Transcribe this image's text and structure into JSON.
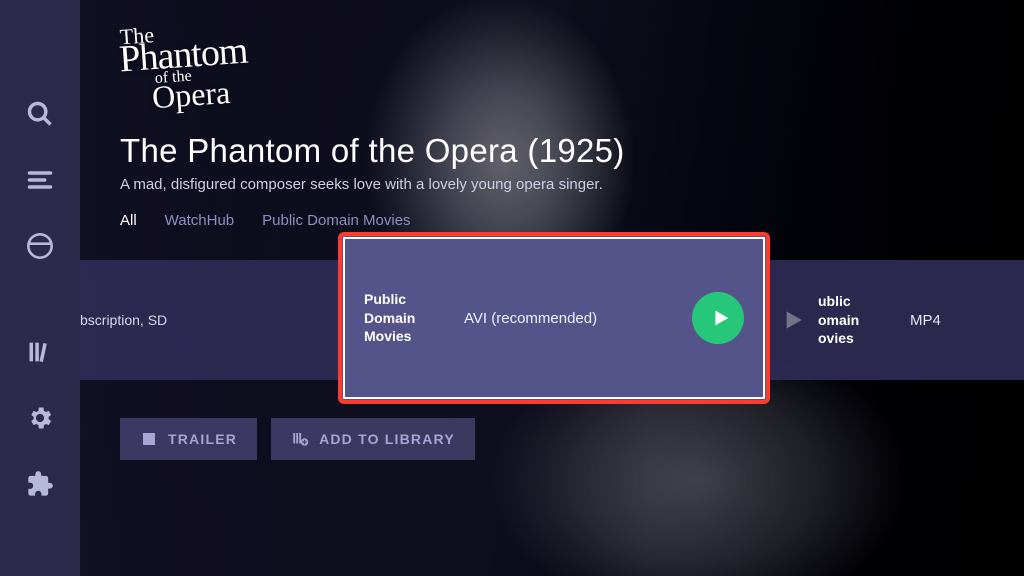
{
  "movie": {
    "title": "The Phantom of the Opera (1925)",
    "synopsis": "A mad, disfigured composer seeks love with a lovely young opera singer."
  },
  "tabs": {
    "all": "All",
    "watchhub": "WatchHub",
    "pdm": "Public Domain Movies"
  },
  "streams": {
    "left_clip": "bscription, SD",
    "highlight": {
      "provider": "Public Domain Movies",
      "format": "AVI (recommended)"
    },
    "right": {
      "provider_l1": "ublic",
      "provider_l2": "omain",
      "provider_l3": "ovies",
      "format": "MP4"
    }
  },
  "actions": {
    "trailer": "TRAILER",
    "add_library": "ADD TO LIBRARY"
  }
}
